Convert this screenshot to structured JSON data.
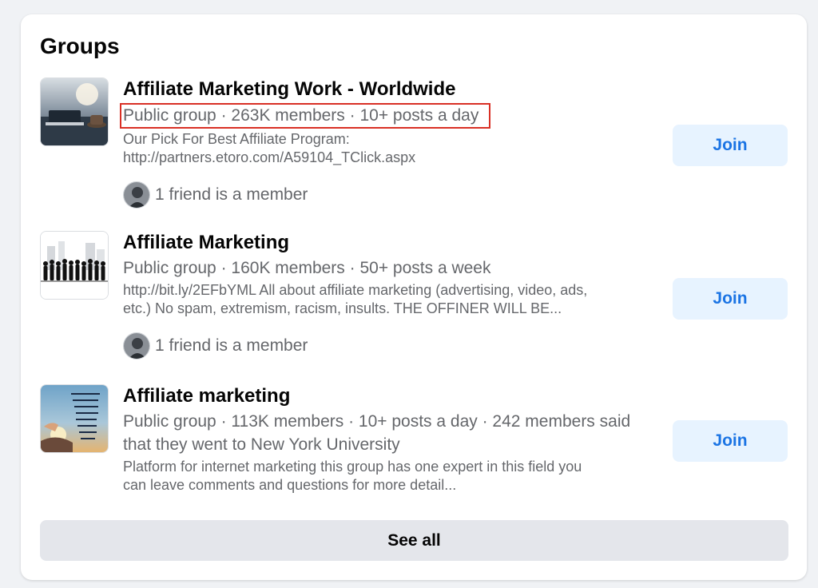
{
  "section": {
    "title": "Groups"
  },
  "groups": [
    {
      "name": "Affiliate Marketing Work - Worldwide",
      "meta": "Public group · 263K members · 10+ posts a day",
      "description_line1": "Our Pick For Best Affiliate Program:",
      "description_line2": "http://partners.etoro.com/A59104_TClick.aspx",
      "friends": "1 friend is a member",
      "join_label": "Join"
    },
    {
      "name": "Affiliate Marketing",
      "meta": "Public group · 160K members · 50+ posts a week",
      "description_line1": "http://bit.ly/2EFbYML All about affiliate marketing (advertising, video, ads,",
      "description_line2": "etc.) No spam, extremism, racism, insults. THE OFFINER WILL BE...",
      "friends": "1 friend is a member",
      "join_label": "Join"
    },
    {
      "name": "Affiliate marketing",
      "meta_line1": "Public group · 113K members · 10+ posts a day · 242 members said",
      "meta_line2": "that they went to New York University",
      "description_line1": "Platform for internet marketing this group has one expert in this field you",
      "description_line2": "can leave comments and questions for more detail...",
      "join_label": "Join"
    }
  ],
  "see_all_label": "See all",
  "colors": {
    "accent": "#1b74e4",
    "join_bg": "#e7f3ff",
    "highlight_box": "#d93025",
    "secondary_text": "#65676b"
  }
}
